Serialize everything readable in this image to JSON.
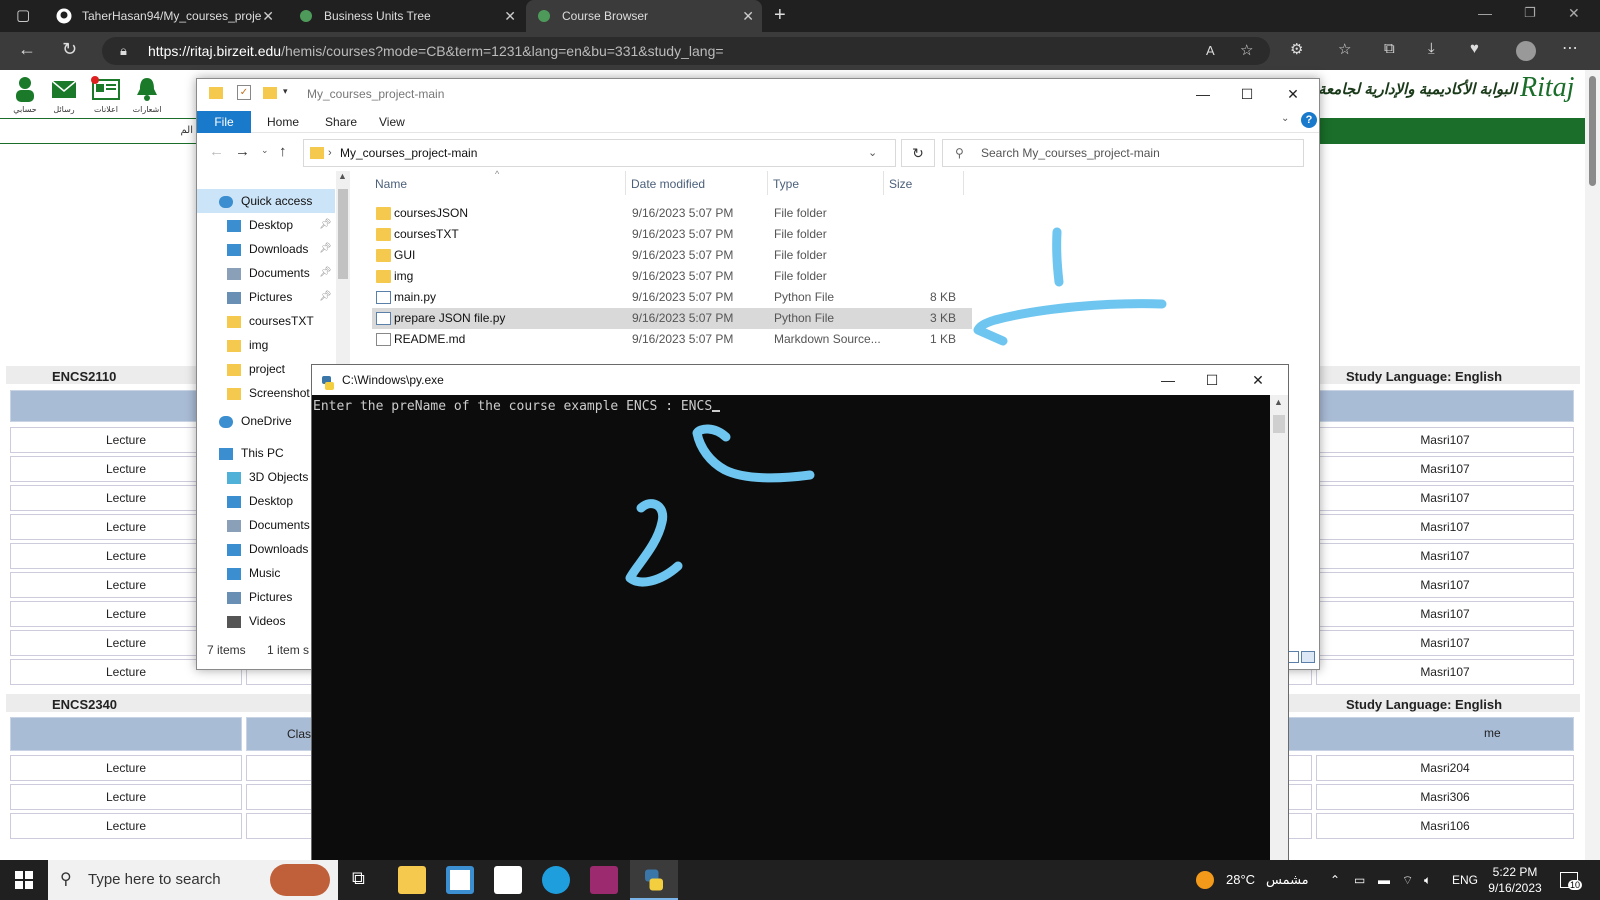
{
  "browser": {
    "tabs": [
      {
        "title": "TaherHasan94/My_courses_proje",
        "icon": "github-icon"
      },
      {
        "title": "Business Units Tree",
        "icon": "ritaj-icon"
      },
      {
        "title": "Course Browser",
        "icon": "ritaj-icon",
        "active": true
      }
    ],
    "url_host": "https://ritaj.birzeit.edu",
    "url_path": "/hemis/courses?mode=CB&term=1231&lang=en&bu=331&study_lang="
  },
  "ritaj": {
    "header_arabic": "البوابة الأكاديمية والإدارية لجامعة",
    "logo_text": "Ritaj",
    "top_icons": [
      {
        "label": "حسابي",
        "icon": "person-icon"
      },
      {
        "label": "رسائل",
        "icon": "mail-icon"
      },
      {
        "label": "اعلانات",
        "icon": "news-icon"
      },
      {
        "label": "اشعارات",
        "icon": "bell-icon"
      }
    ],
    "search_hint": "الم",
    "sections": [
      {
        "code": "ENCS2110",
        "study_language": "Study Language: English",
        "rows": [
          {
            "type": "Lecture",
            "room": "Masri107"
          },
          {
            "type": "Lecture",
            "room": "Masri107"
          },
          {
            "type": "Lecture",
            "room": "Masri107"
          },
          {
            "type": "Lecture",
            "room": "Masri107"
          },
          {
            "type": "Lecture",
            "room": "Masri107"
          },
          {
            "type": "Lecture",
            "room": "Masri107"
          },
          {
            "type": "Lecture",
            "room": "Masri107"
          },
          {
            "type": "Lecture",
            "room": "Masri107"
          },
          {
            "type": "Lecture",
            "room": "Masri107"
          }
        ]
      },
      {
        "code": "ENCS2340",
        "study_language": "Study Language: English",
        "header_left": "Clas",
        "header_right": "me",
        "rows": [
          {
            "type": "Lecture",
            "room": "Masri204"
          },
          {
            "type": "Lecture",
            "room": "Masri306"
          },
          {
            "type": "Lecture",
            "room": "Masri106"
          }
        ]
      }
    ]
  },
  "explorer": {
    "title": "My_courses_project-main",
    "ribbon": [
      "File",
      "Home",
      "Share",
      "View"
    ],
    "address": "My_courses_project-main",
    "search_placeholder": "Search My_courses_project-main",
    "columns": [
      "Name",
      "Date modified",
      "Type",
      "Size"
    ],
    "nav": [
      {
        "label": "Quick access",
        "icon": "star-icon"
      },
      {
        "label": "Desktop",
        "icon": "desktop-icon",
        "pinned": true
      },
      {
        "label": "Downloads",
        "icon": "download-icon",
        "pinned": true
      },
      {
        "label": "Documents",
        "icon": "document-icon",
        "pinned": true
      },
      {
        "label": "Pictures",
        "icon": "pictures-icon",
        "pinned": true
      },
      {
        "label": "coursesTXT",
        "icon": "folder-icon"
      },
      {
        "label": "img",
        "icon": "folder-icon"
      },
      {
        "label": "project",
        "icon": "folder-icon"
      },
      {
        "label": "Screenshot",
        "icon": "folder-icon"
      },
      {
        "label": "OneDrive",
        "icon": "cloud-icon"
      },
      {
        "label": "This PC",
        "icon": "pc-icon"
      },
      {
        "label": "3D Objects",
        "icon": "cube-icon"
      },
      {
        "label": "Desktop",
        "icon": "desktop-icon"
      },
      {
        "label": "Documents",
        "icon": "document-icon"
      },
      {
        "label": "Downloads",
        "icon": "download-icon"
      },
      {
        "label": "Music",
        "icon": "music-icon"
      },
      {
        "label": "Pictures",
        "icon": "pictures-icon"
      },
      {
        "label": "Videos",
        "icon": "video-icon"
      }
    ],
    "files": [
      {
        "name": "coursesJSON",
        "date": "9/16/2023 5:07 PM",
        "type": "File folder",
        "size": "",
        "icon": "folder-icon"
      },
      {
        "name": "coursesTXT",
        "date": "9/16/2023 5:07 PM",
        "type": "File folder",
        "size": "",
        "icon": "folder-icon"
      },
      {
        "name": "GUI",
        "date": "9/16/2023 5:07 PM",
        "type": "File folder",
        "size": "",
        "icon": "folder-icon"
      },
      {
        "name": "img",
        "date": "9/16/2023 5:07 PM",
        "type": "File folder",
        "size": "",
        "icon": "folder-icon"
      },
      {
        "name": "main.py",
        "date": "9/16/2023 5:07 PM",
        "type": "Python File",
        "size": "8 KB",
        "icon": "python-file-icon"
      },
      {
        "name": "prepare JSON file.py",
        "date": "9/16/2023 5:07 PM",
        "type": "Python File",
        "size": "3 KB",
        "icon": "python-file-icon",
        "selected": true
      },
      {
        "name": "README.md",
        "date": "9/16/2023 5:07 PM",
        "type": "Markdown Source...",
        "size": "1 KB",
        "icon": "markdown-file-icon"
      }
    ],
    "status_items": "7 items",
    "status_selected": "1 item s"
  },
  "console": {
    "title": "C:\\Windows\\py.exe",
    "prompt": "Enter the preName of the course example ENCS : ENCS"
  },
  "annotations": {
    "label_1": "1",
    "label_2": "2",
    "color": "#6ec6f0"
  },
  "taskbar": {
    "search_placeholder": "Type here to search",
    "weather": "28°C",
    "weather_text": "مشمس",
    "language": "ENG",
    "time": "5:22 PM",
    "date": "9/16/2023",
    "notification_count": "10"
  },
  "colors": {
    "ritaj_green": "#1a6e2a",
    "table_header_blue": "#a9bcd6",
    "explorer_file_tab": "#1979ca",
    "console_bg": "#0c0c0c"
  }
}
